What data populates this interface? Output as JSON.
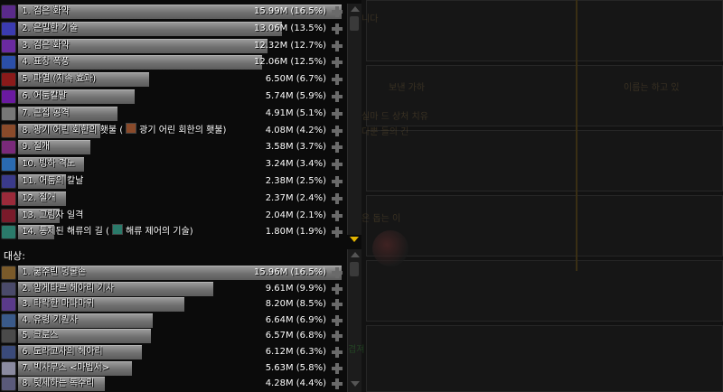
{
  "damage": {
    "rows": [
      {
        "rank": "1.",
        "name": "검은 화약",
        "amount": "15.99M",
        "pct": "(16.5%)",
        "fill": 1.0,
        "icon": "shadow-icon",
        "icon_color": "#5a2a8a"
      },
      {
        "rank": "2.",
        "name": "은밀한 기술",
        "amount": "13.06M",
        "pct": "(13.5%)",
        "fill": 0.817,
        "icon": "eviscerate-icon",
        "icon_color": "#3b3bb0"
      },
      {
        "rank": "3.",
        "name": "검은 화약",
        "amount": "12.32M",
        "pct": "(12.7%)",
        "fill": 0.77,
        "icon": "shadow-icon",
        "icon_color": "#6a2aa0"
      },
      {
        "rank": "4.",
        "name": "표창 폭풍",
        "amount": "12.06M",
        "pct": "(12.5%)",
        "fill": 0.754,
        "icon": "shuriken-icon",
        "icon_color": "#2b4fa8"
      },
      {
        "rank": "5.",
        "name": "파열 (지속 효과)",
        "amount": "6.50M",
        "pct": "(6.7%)",
        "fill": 0.406,
        "icon": "rupture-icon",
        "icon_color": "#8a1a1a"
      },
      {
        "rank": "6.",
        "name": "어둠칼날",
        "amount": "5.74M",
        "pct": "(5.9%)",
        "fill": 0.359,
        "icon": "shadow-blade-icon",
        "icon_color": "#6a1aa0"
      },
      {
        "rank": "7.",
        "name": "근접 공격",
        "amount": "4.91M",
        "pct": "(5.1%)",
        "fill": 0.307,
        "icon": "melee-icon",
        "icon_color": "#777777"
      },
      {
        "rank": "8.",
        "name": "광기 어린 회한의 횃불 (",
        "name2": "광기 어린 회한의 횃불)",
        "amount": "4.08M",
        "pct": "(4.2%)",
        "fill": 0.255,
        "icon": "torch-icon",
        "icon_color": "#8a4a2a"
      },
      {
        "rank": "9.",
        "name": "절개",
        "amount": "3.58M",
        "pct": "(3.7%)",
        "fill": 0.224,
        "icon": "gash-icon",
        "icon_color": "#7a2a7a"
      },
      {
        "rank": "10.",
        "name": "빙하 격노",
        "amount": "3.24M",
        "pct": "(3.4%)",
        "fill": 0.203,
        "icon": "frost-icon",
        "icon_color": "#2a6ab0"
      },
      {
        "rank": "11.",
        "name": "어둠의 칼날",
        "amount": "2.38M",
        "pct": "(2.5%)",
        "fill": 0.149,
        "icon": "dark-blade-icon",
        "icon_color": "#3a3a8a"
      },
      {
        "rank": "12.",
        "name": "절개",
        "amount": "2.37M",
        "pct": "(2.4%)",
        "fill": 0.148,
        "icon": "gash-icon",
        "icon_color": "#9a2a3a"
      },
      {
        "rank": "13.",
        "name": "그림자 일격",
        "amount": "2.04M",
        "pct": "(2.1%)",
        "fill": 0.128,
        "icon": "shadow-strike-icon",
        "icon_color": "#7a1a2a"
      },
      {
        "rank": "14.",
        "name": "통제된 해류의 길 (",
        "name2": "해류 제어의 기술)",
        "amount": "1.80M",
        "pct": "(1.9%)",
        "fill": 0.113,
        "icon": "current-icon",
        "icon_color": "#2a7a6a"
      }
    ]
  },
  "targets": {
    "heading": "대상:",
    "rows": [
      {
        "rank": "1.",
        "name": "굶주린 덩굴손",
        "amount": "15.96M",
        "pct": "(16.5%)",
        "fill": 1.0,
        "icon": "tendril-icon",
        "icon_color": "#7a5a2a"
      },
      {
        "rank": "2.",
        "name": "암게타르 헤아리 기사",
        "amount": "9.61M",
        "pct": "(9.9%)",
        "fill": 0.602,
        "icon": "knight-icon",
        "icon_color": "#4a4a6a"
      },
      {
        "rank": "3.",
        "name": "타락한 마나마귀",
        "amount": "8.20M",
        "pct": "(8.5%)",
        "fill": 0.514,
        "icon": "mana-wyrm-icon",
        "icon_color": "#5a3a8a"
      },
      {
        "rank": "4.",
        "name": "유령 기원사",
        "amount": "6.64M",
        "pct": "(6.9%)",
        "fill": 0.416,
        "icon": "ghost-icon",
        "icon_color": "#3a5a8a"
      },
      {
        "rank": "5.",
        "name": "크로스",
        "amount": "6.57M",
        "pct": "(6.8%)",
        "fill": 0.412,
        "icon": "cross-icon",
        "icon_color": "#4a4a4a"
      },
      {
        "rank": "6.",
        "name": "도라고사의 헤아리",
        "amount": "6.12M",
        "pct": "(6.3%)",
        "fill": 0.383,
        "icon": "elf-icon",
        "icon_color": "#3a4a7a"
      },
      {
        "rank": "7.",
        "name": "빅사무스 <마법서>",
        "amount": "5.63M",
        "pct": "(5.8%)",
        "fill": 0.353,
        "icon": "grimoire-icon",
        "icon_color": "#8a8aa0"
      },
      {
        "rank": "8.",
        "name": "텃세하는 독수리",
        "amount": "4.28M",
        "pct": "(4.4%)",
        "fill": 0.268,
        "icon": "vulture-icon",
        "icon_color": "#5a5a7a"
      }
    ]
  },
  "background_text": [
    "니다",
    "보낸 가하",
    "이름는 하고 있",
    "실마 드 상처 치유",
    "다뿐 들의 긴",
    "은 돕는 이",
    "겹져"
  ]
}
